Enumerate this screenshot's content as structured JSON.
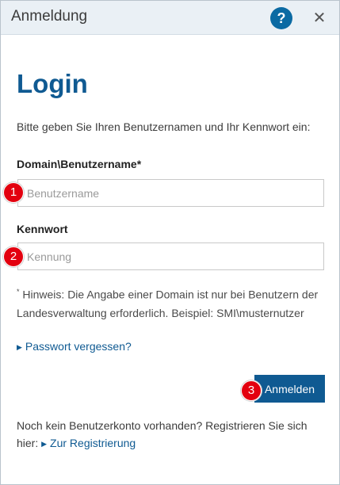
{
  "dialog": {
    "title": "Anmeldung",
    "help_glyph": "?",
    "close_glyph": "✕"
  },
  "heading": "Login",
  "intro": "Bitte geben Sie Ihren Benutzernamen und Ihr Kennwort ein:",
  "username": {
    "label": "Domain\\Benutzername",
    "required_marker": "*",
    "placeholder": "Benutzername",
    "value": ""
  },
  "password": {
    "label": "Kennwort",
    "placeholder": "Kennung",
    "value": ""
  },
  "hint": {
    "marker": "*",
    "text": "Hinweis: Die Angabe einer Domain ist nur bei Benutzern der Landesverwaltung erforderlich. Beispiel: SMI\\musternutzer"
  },
  "forgot_link": "Passwort vergessen?",
  "login_button": "Anmelden",
  "footer": {
    "text": "Noch kein Benutzerkonto vorhanden? Registrieren Sie sich hier:",
    "register_link": "Zur Registrierung"
  },
  "step_badges": [
    "1",
    "2",
    "3"
  ],
  "colors": {
    "accent": "#0f5a92",
    "help": "#0b6aa3",
    "badge": "#e3000f",
    "titlebar": "#eaf0f5"
  },
  "icons": {
    "help": "question-icon",
    "close": "close-icon",
    "link_arrow": "triangle-right-icon"
  }
}
